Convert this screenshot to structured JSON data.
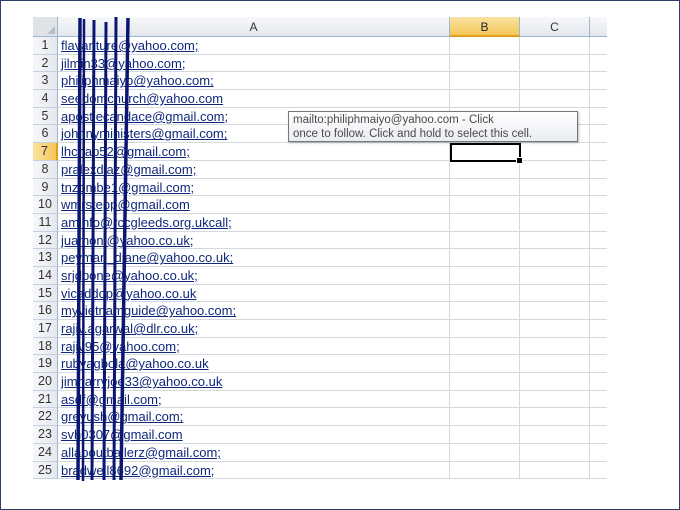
{
  "columns": [
    {
      "label": "A",
      "selected": false
    },
    {
      "label": "B",
      "selected": true
    },
    {
      "label": "C",
      "selected": false
    }
  ],
  "active_row": 7,
  "rows": [
    {
      "num": "1",
      "email": "flavanture@yahoo.com;"
    },
    {
      "num": "2",
      "email": "jilmin33@yahoo.com;"
    },
    {
      "num": "3",
      "email": "philiphmaiyo@yahoo.com;"
    },
    {
      "num": "4",
      "email": "seedomchurch@yahoo.com"
    },
    {
      "num": "5",
      "email": "apostlecandace@gmail.com;"
    },
    {
      "num": "6",
      "email": "johnnyministers@gmail.com;"
    },
    {
      "num": "7",
      "email": "lhchap52@gmail.com;"
    },
    {
      "num": "8",
      "email": "pralexdiaz@gmail.com;"
    },
    {
      "num": "9",
      "email": "tnzombe1@gmail.com;"
    },
    {
      "num": "10",
      "email": "wmrstepp@gmail.com"
    },
    {
      "num": "11",
      "email": "aminfo@rccgleeds.org.ukcall;"
    },
    {
      "num": "12",
      "email": "juamoni@yahoo.co.uk;"
    },
    {
      "num": "13",
      "email": "peyman_diane@yahoo.co.uk;"
    },
    {
      "num": "14",
      "email": "srjdbone@yahoo.co.uk;"
    },
    {
      "num": "15",
      "email": "vicaddop@yahoo.co.uk"
    },
    {
      "num": "16",
      "email": "myvietnamguide@yahoo.com;"
    },
    {
      "num": "17",
      "email": "rajiv.agarwal@dlr.co.uk;"
    },
    {
      "num": "18",
      "email": "rajiv95@yahoo.com;"
    },
    {
      "num": "19",
      "email": "rubyagbola@yahoo.co.uk"
    },
    {
      "num": "20",
      "email": "jimharryjoe33@yahoo.co.uk"
    },
    {
      "num": "21",
      "email": "asdf@gmail.com;"
    },
    {
      "num": "22",
      "email": "greyush@gmail.com;"
    },
    {
      "num": "23",
      "email": "svh0307@gmail.com"
    },
    {
      "num": "24",
      "email": "allaboutballerz@gmail.com;"
    },
    {
      "num": "25",
      "email": "bradwell8692@gmail.com;"
    }
  ],
  "tooltip": {
    "line1": "mailto:philiphmaiyo@yahoo.com - Click",
    "line2": "once to follow. Click and hold to select this cell."
  },
  "colors": {
    "hyperlink": "#10287a",
    "redaction_lines": "#0b1670",
    "header_selected": "#f4c75a",
    "gridline": "#d4d9df"
  }
}
